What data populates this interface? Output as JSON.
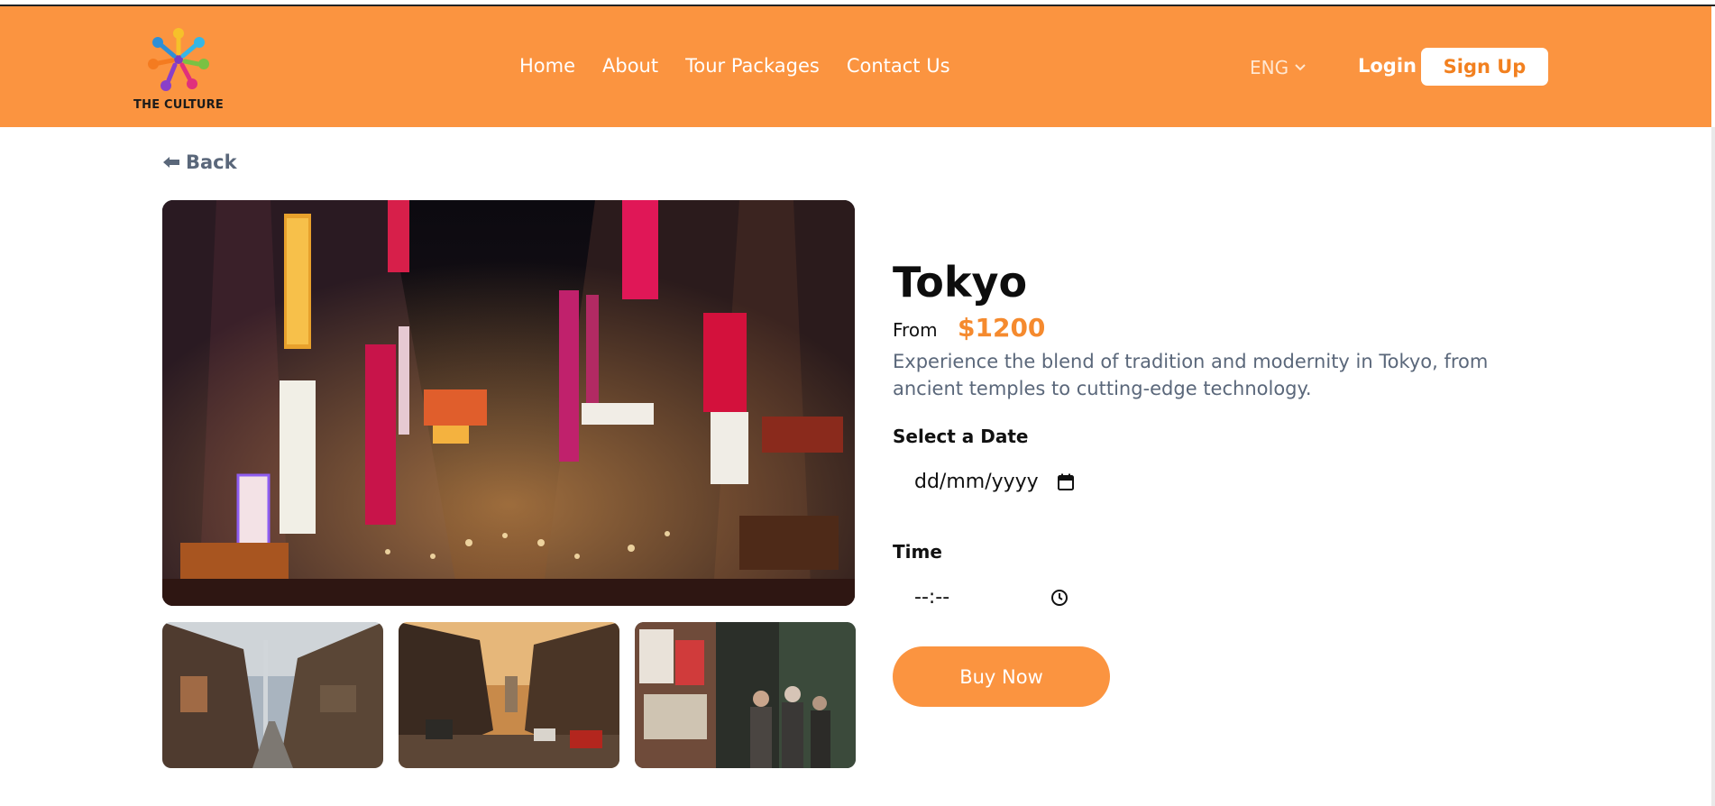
{
  "brand": {
    "name": "THE CULTURE"
  },
  "nav": {
    "items": [
      "Home",
      "About",
      "Tour Packages",
      "Contact Us"
    ]
  },
  "header": {
    "language": "ENG",
    "login_label": "Login",
    "signup_label": "Sign Up"
  },
  "back_label": "Back",
  "gallery": {
    "main_image": "tokyo-neon-street-night",
    "thumbnails": [
      "tokyo-alley-tower",
      "tokyo-street-sunset",
      "tokyo-crowd-night"
    ]
  },
  "tour": {
    "title": "Tokyo",
    "from_label": "From",
    "price": "$1200",
    "description": "Experience the blend of tradition and modernity in Tokyo, from ancient temples to cutting-edge technology."
  },
  "booking": {
    "date_label": "Select a Date",
    "date_placeholder": "dd/mm/yyyy",
    "time_label": "Time",
    "time_placeholder": "--:--",
    "buy_label": "Buy Now"
  },
  "colors": {
    "accent": "#fb9440",
    "price": "#f58a2e",
    "muted_text": "#5a677a"
  },
  "icons": [
    "logo-icon",
    "chevron-down-icon",
    "arrow-left-icon",
    "calendar-icon",
    "clock-icon"
  ]
}
